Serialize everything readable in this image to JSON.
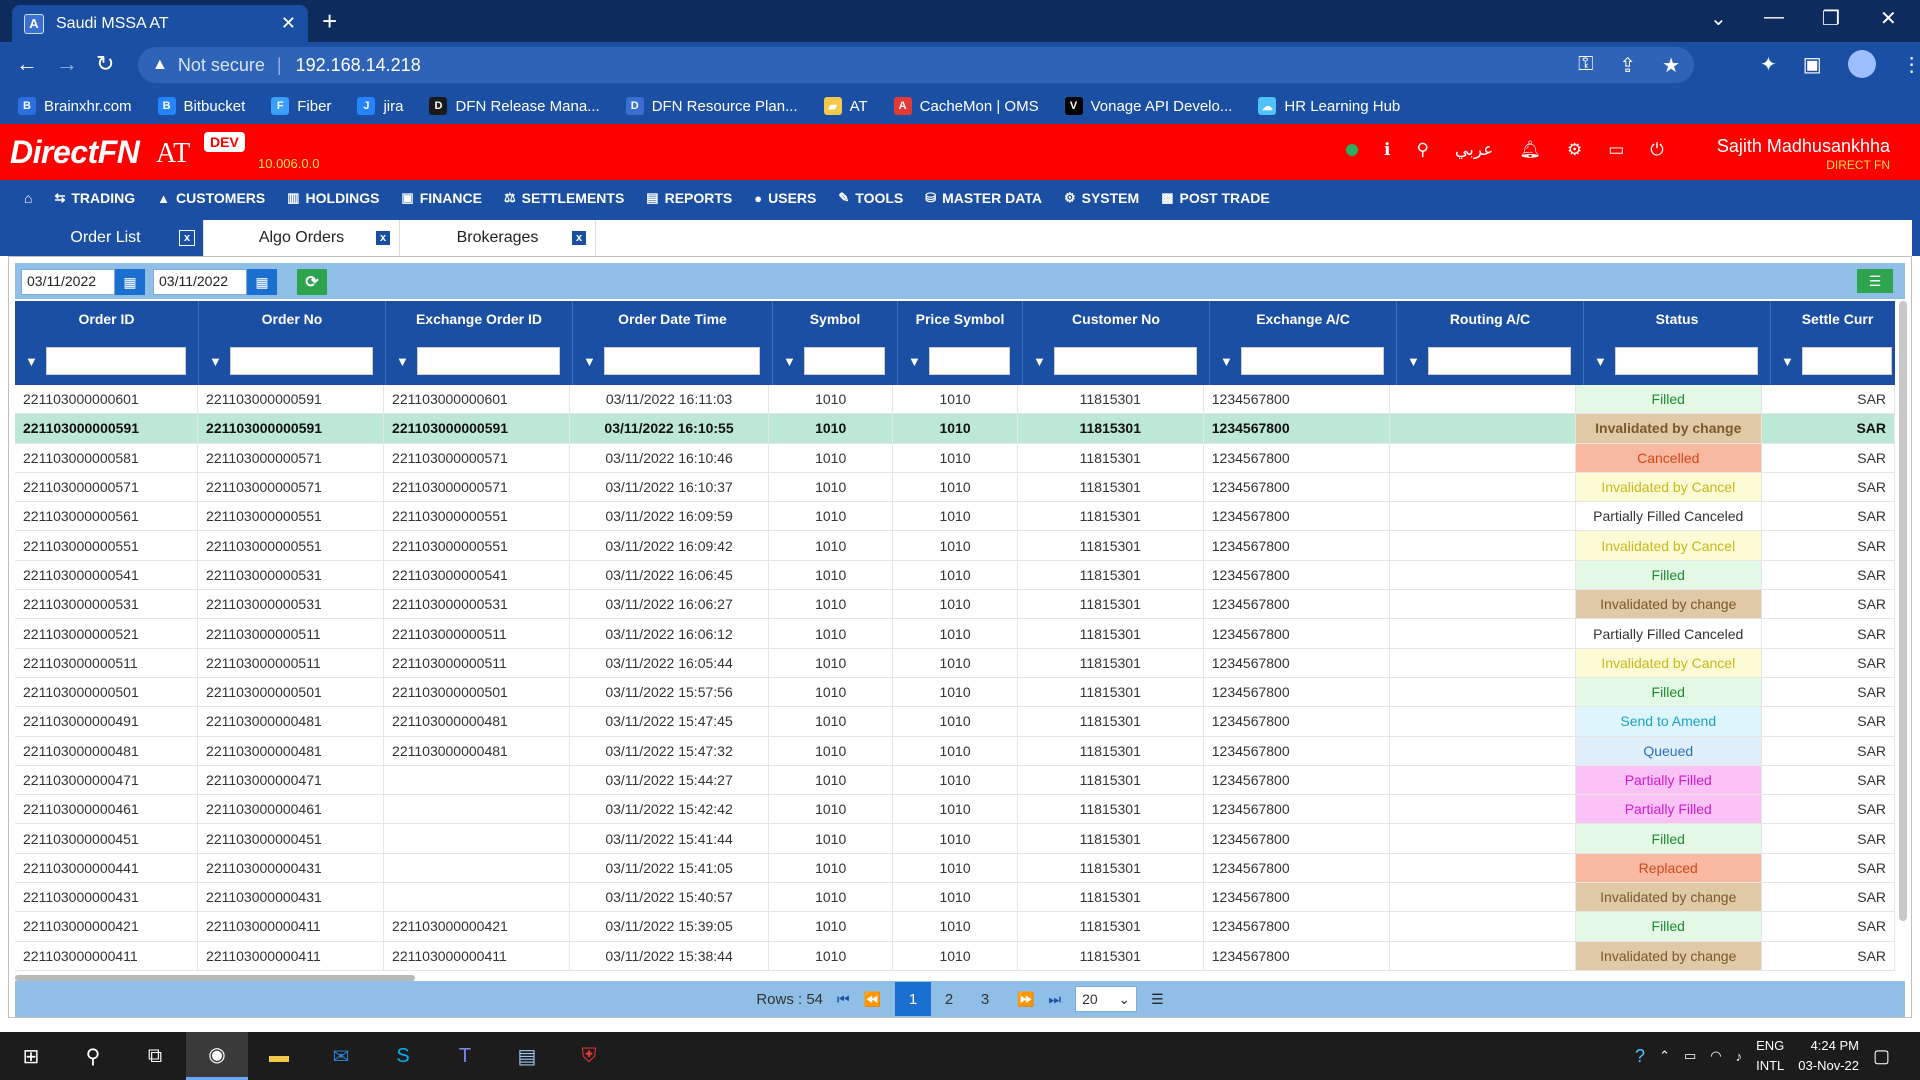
{
  "browser": {
    "tab_title": "Saudi MSSA AT",
    "not_secure": "Not secure",
    "url": "192.168.14.218"
  },
  "bookmarks": [
    {
      "label": "Brainxhr.com",
      "icon": "brainxhr-icon",
      "color": "#2b6fe0"
    },
    {
      "label": "Bitbucket",
      "icon": "bitbucket-icon",
      "color": "#2684ff"
    },
    {
      "label": "Fiber",
      "icon": "fiber-icon",
      "color": "#3aa0ff"
    },
    {
      "label": "jira",
      "icon": "jira-icon",
      "color": "#2684ff"
    },
    {
      "label": "DFN Release Mana...",
      "icon": "dfn-release-icon",
      "color": "#1a1a1a"
    },
    {
      "label": "DFN Resource Plan...",
      "icon": "dfn-resource-icon",
      "color": "#3a6fd1"
    },
    {
      "label": "AT",
      "icon": "folder-icon",
      "color": "#f2c94c"
    },
    {
      "label": "CacheMon | OMS",
      "icon": "cachemon-icon",
      "color": "#e53935"
    },
    {
      "label": "Vonage API Develo...",
      "icon": "vonage-icon",
      "color": "#000000"
    },
    {
      "label": "HR Learning Hub",
      "icon": "cloud-icon",
      "color": "#4fc3f7"
    }
  ],
  "app": {
    "logo": "DirectFN",
    "logo_suffix": "AT",
    "env_badge": "DEV",
    "version": "10.006.0.0",
    "lang_switch": "عربي",
    "user_name": "Sajith Madhusankhha",
    "company": "DIRECT FN"
  },
  "menu": [
    {
      "label": "TRADING",
      "icon": "trading-icon"
    },
    {
      "label": "CUSTOMERS",
      "icon": "customers-icon"
    },
    {
      "label": "HOLDINGS",
      "icon": "holdings-icon"
    },
    {
      "label": "FINANCE",
      "icon": "finance-icon"
    },
    {
      "label": "SETTLEMENTS",
      "icon": "settlements-icon"
    },
    {
      "label": "REPORTS",
      "icon": "reports-icon"
    },
    {
      "label": "USERS",
      "icon": "users-icon"
    },
    {
      "label": "TOOLS",
      "icon": "tools-icon"
    },
    {
      "label": "MASTER DATA",
      "icon": "master-data-icon"
    },
    {
      "label": "SYSTEM",
      "icon": "system-icon"
    },
    {
      "label": "POST TRADE",
      "icon": "post-trade-icon"
    }
  ],
  "workspace_tabs": [
    {
      "label": "Order List",
      "active": true
    },
    {
      "label": "Algo Orders",
      "active": false
    },
    {
      "label": "Brokerages",
      "active": false
    }
  ],
  "filters": {
    "from_date": "03/11/2022",
    "to_date": "03/11/2022"
  },
  "columns": [
    "Order ID",
    "Order No",
    "Exchange Order ID",
    "Order Date Time",
    "Symbol",
    "Price Symbol",
    "Customer No",
    "Exchange A/C",
    "Routing A/C",
    "Status",
    "Settle Curr"
  ],
  "status_styles": {
    "Filled": {
      "bg": "#e3f9e5",
      "fg": "#1e8a2e"
    },
    "Invalidated by change": {
      "bg": "#e0c9a6",
      "fg": "#7a5a2a"
    },
    "Cancelled": {
      "bg": "#f9b8a0",
      "fg": "#d14a1a"
    },
    "Invalidated by Cancel": {
      "bg": "#fdfbd6",
      "fg": "#c9b81a"
    },
    "Partially Filled Canceled": {
      "bg": "#ffffff",
      "fg": "#333333"
    },
    "Send to Amend": {
      "bg": "#def6fb",
      "fg": "#1aa3c0"
    },
    "Queued": {
      "bg": "#e1effb",
      "fg": "#2b6fbf"
    },
    "Partially Filled": {
      "bg": "#fbc2f5",
      "fg": "#d11ad1"
    },
    "Replaced": {
      "bg": "#f9b8a0",
      "fg": "#d14a1a"
    }
  },
  "rows": [
    {
      "order_id": "221103000000601",
      "order_no": "221103000000591",
      "exch_order_id": "221103000000601",
      "datetime": "03/11/2022 16:11:03",
      "symbol": "1010",
      "price_symbol": "1010",
      "customer_no": "11815301",
      "exchange_ac": "1234567800",
      "routing_ac": "",
      "status": "Filled",
      "settle_curr": "SAR"
    },
    {
      "order_id": "221103000000591",
      "order_no": "221103000000591",
      "exch_order_id": "221103000000591",
      "datetime": "03/11/2022 16:10:55",
      "symbol": "1010",
      "price_symbol": "1010",
      "customer_no": "11815301",
      "exchange_ac": "1234567800",
      "routing_ac": "",
      "status": "Invalidated by change",
      "settle_curr": "SAR",
      "selected": true
    },
    {
      "order_id": "221103000000581",
      "order_no": "221103000000571",
      "exch_order_id": "221103000000571",
      "datetime": "03/11/2022 16:10:46",
      "symbol": "1010",
      "price_symbol": "1010",
      "customer_no": "11815301",
      "exchange_ac": "1234567800",
      "routing_ac": "",
      "status": "Cancelled",
      "settle_curr": "SAR"
    },
    {
      "order_id": "221103000000571",
      "order_no": "221103000000571",
      "exch_order_id": "221103000000571",
      "datetime": "03/11/2022 16:10:37",
      "symbol": "1010",
      "price_symbol": "1010",
      "customer_no": "11815301",
      "exchange_ac": "1234567800",
      "routing_ac": "",
      "status": "Invalidated by Cancel",
      "settle_curr": "SAR"
    },
    {
      "order_id": "221103000000561",
      "order_no": "221103000000551",
      "exch_order_id": "221103000000551",
      "datetime": "03/11/2022 16:09:59",
      "symbol": "1010",
      "price_symbol": "1010",
      "customer_no": "11815301",
      "exchange_ac": "1234567800",
      "routing_ac": "",
      "status": "Partially Filled Canceled",
      "settle_curr": "SAR"
    },
    {
      "order_id": "221103000000551",
      "order_no": "221103000000551",
      "exch_order_id": "221103000000551",
      "datetime": "03/11/2022 16:09:42",
      "symbol": "1010",
      "price_symbol": "1010",
      "customer_no": "11815301",
      "exchange_ac": "1234567800",
      "routing_ac": "",
      "status": "Invalidated by Cancel",
      "settle_curr": "SAR"
    },
    {
      "order_id": "221103000000541",
      "order_no": "221103000000531",
      "exch_order_id": "221103000000541",
      "datetime": "03/11/2022 16:06:45",
      "symbol": "1010",
      "price_symbol": "1010",
      "customer_no": "11815301",
      "exchange_ac": "1234567800",
      "routing_ac": "",
      "status": "Filled",
      "settle_curr": "SAR"
    },
    {
      "order_id": "221103000000531",
      "order_no": "221103000000531",
      "exch_order_id": "221103000000531",
      "datetime": "03/11/2022 16:06:27",
      "symbol": "1010",
      "price_symbol": "1010",
      "customer_no": "11815301",
      "exchange_ac": "1234567800",
      "routing_ac": "",
      "status": "Invalidated by change",
      "settle_curr": "SAR"
    },
    {
      "order_id": "221103000000521",
      "order_no": "221103000000511",
      "exch_order_id": "221103000000511",
      "datetime": "03/11/2022 16:06:12",
      "symbol": "1010",
      "price_symbol": "1010",
      "customer_no": "11815301",
      "exchange_ac": "1234567800",
      "routing_ac": "",
      "status": "Partially Filled Canceled",
      "settle_curr": "SAR"
    },
    {
      "order_id": "221103000000511",
      "order_no": "221103000000511",
      "exch_order_id": "221103000000511",
      "datetime": "03/11/2022 16:05:44",
      "symbol": "1010",
      "price_symbol": "1010",
      "customer_no": "11815301",
      "exchange_ac": "1234567800",
      "routing_ac": "",
      "status": "Invalidated by Cancel",
      "settle_curr": "SAR"
    },
    {
      "order_id": "221103000000501",
      "order_no": "221103000000501",
      "exch_order_id": "221103000000501",
      "datetime": "03/11/2022 15:57:56",
      "symbol": "1010",
      "price_symbol": "1010",
      "customer_no": "11815301",
      "exchange_ac": "1234567800",
      "routing_ac": "",
      "status": "Filled",
      "settle_curr": "SAR"
    },
    {
      "order_id": "221103000000491",
      "order_no": "221103000000481",
      "exch_order_id": "221103000000481",
      "datetime": "03/11/2022 15:47:45",
      "symbol": "1010",
      "price_symbol": "1010",
      "customer_no": "11815301",
      "exchange_ac": "1234567800",
      "routing_ac": "",
      "status": "Send to Amend",
      "settle_curr": "SAR"
    },
    {
      "order_id": "221103000000481",
      "order_no": "221103000000481",
      "exch_order_id": "221103000000481",
      "datetime": "03/11/2022 15:47:32",
      "symbol": "1010",
      "price_symbol": "1010",
      "customer_no": "11815301",
      "exchange_ac": "1234567800",
      "routing_ac": "",
      "status": "Queued",
      "settle_curr": "SAR"
    },
    {
      "order_id": "221103000000471",
      "order_no": "221103000000471",
      "exch_order_id": "",
      "datetime": "03/11/2022 15:44:27",
      "symbol": "1010",
      "price_symbol": "1010",
      "customer_no": "11815301",
      "exchange_ac": "1234567800",
      "routing_ac": "",
      "status": "Partially Filled",
      "settle_curr": "SAR"
    },
    {
      "order_id": "221103000000461",
      "order_no": "221103000000461",
      "exch_order_id": "",
      "datetime": "03/11/2022 15:42:42",
      "symbol": "1010",
      "price_symbol": "1010",
      "customer_no": "11815301",
      "exchange_ac": "1234567800",
      "routing_ac": "",
      "status": "Partially Filled",
      "settle_curr": "SAR"
    },
    {
      "order_id": "221103000000451",
      "order_no": "221103000000451",
      "exch_order_id": "",
      "datetime": "03/11/2022 15:41:44",
      "symbol": "1010",
      "price_symbol": "1010",
      "customer_no": "11815301",
      "exchange_ac": "1234567800",
      "routing_ac": "",
      "status": "Filled",
      "settle_curr": "SAR"
    },
    {
      "order_id": "221103000000441",
      "order_no": "221103000000431",
      "exch_order_id": "",
      "datetime": "03/11/2022 15:41:05",
      "symbol": "1010",
      "price_symbol": "1010",
      "customer_no": "11815301",
      "exchange_ac": "1234567800",
      "routing_ac": "",
      "status": "Replaced",
      "settle_curr": "SAR"
    },
    {
      "order_id": "221103000000431",
      "order_no": "221103000000431",
      "exch_order_id": "",
      "datetime": "03/11/2022 15:40:57",
      "symbol": "1010",
      "price_symbol": "1010",
      "customer_no": "11815301",
      "exchange_ac": "1234567800",
      "routing_ac": "",
      "status": "Invalidated by change",
      "settle_curr": "SAR"
    },
    {
      "order_id": "221103000000421",
      "order_no": "221103000000411",
      "exch_order_id": "221103000000421",
      "datetime": "03/11/2022 15:39:05",
      "symbol": "1010",
      "price_symbol": "1010",
      "customer_no": "11815301",
      "exchange_ac": "1234567800",
      "routing_ac": "",
      "status": "Filled",
      "settle_curr": "SAR"
    },
    {
      "order_id": "221103000000411",
      "order_no": "221103000000411",
      "exch_order_id": "221103000000411",
      "datetime": "03/11/2022 15:38:44",
      "symbol": "1010",
      "price_symbol": "1010",
      "customer_no": "11815301",
      "exchange_ac": "1234567800",
      "routing_ac": "",
      "status": "Invalidated by change",
      "settle_curr": "SAR"
    }
  ],
  "pager": {
    "rows_label": "Rows : 54",
    "pages": [
      "1",
      "2",
      "3"
    ],
    "current_page": "1",
    "page_size": "20"
  },
  "taskbar": {
    "lang_top": "ENG",
    "lang_bottom": "INTL",
    "time": "4:24 PM",
    "date": "03-Nov-22"
  }
}
